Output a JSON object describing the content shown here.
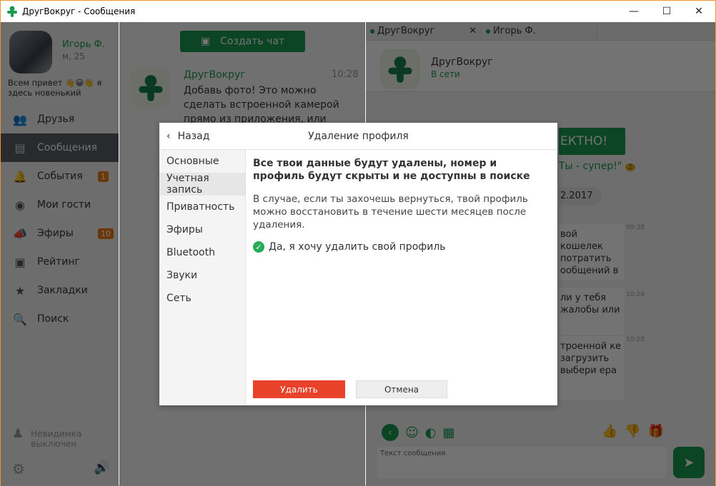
{
  "window": {
    "title": "ДругВокруг - Сообщения",
    "accent": "#1b9a4f",
    "border": "#f0922e"
  },
  "profile": {
    "name": "Игорь Ф.",
    "meta": "м, 25",
    "status": "Всем привет 👋😀👋 я здесь новенький"
  },
  "nav": [
    {
      "label": "Друзья",
      "icon": "people-icon"
    },
    {
      "label": "Сообщения",
      "icon": "chat-icon",
      "active": true
    },
    {
      "label": "События",
      "icon": "bell-icon",
      "badge": "1"
    },
    {
      "label": "Мои гости",
      "icon": "eye-icon"
    },
    {
      "label": "Эфиры",
      "icon": "megaphone-icon",
      "badge": "10"
    },
    {
      "label": "Рейтинг",
      "icon": "rating-icon"
    },
    {
      "label": "Закладки",
      "icon": "star-icon"
    },
    {
      "label": "Поиск",
      "icon": "search-icon"
    }
  ],
  "invisible": {
    "line1": "Невидимка",
    "line2": "выключен"
  },
  "middle": {
    "new_chat": "Создать чат",
    "chat": {
      "name": "ДругВокруг",
      "time": "10:28",
      "preview": "Добавь фото! Это можно сделать встроенной камерой прямо из приложения, или же загрузить"
    }
  },
  "right": {
    "tabs": [
      {
        "label": "ДругВокруг"
      },
      {
        "label": "Игорь Ф."
      }
    ],
    "header": {
      "name": "ДругВокруг",
      "status": "В сети"
    },
    "banner": "ЕКТНО!",
    "super": "Ты - супер!\"",
    "super_badge": "2",
    "date": "2.2017",
    "messages": [
      {
        "text": "вой кошелек потратить ообщений в",
        "time": "09:38"
      },
      {
        "text": "ли у тебя жалобы или",
        "time": "10:28"
      },
      {
        "text": "троенной ке загрузить выбери ера",
        "time": "10:28"
      }
    ],
    "input_placeholder": "Текст сообщения"
  },
  "modal": {
    "back": "Назад",
    "title": "Удаление профиля",
    "menu": [
      "Основные",
      "Учетная запись",
      "Приватность",
      "Эфиры",
      "Bluetooth",
      "Звуки",
      "Сеть"
    ],
    "active_menu": "Учетная запись",
    "heading": "Все твои данные будут удалены, номер и профиль будут скрыты и не доступны в поиске",
    "text": "В случае, если ты захочешь вернуться, твой профиль можно восстановить в течение шести месяцев после удаления.",
    "confirm": "Да, я хочу удалить свой профиль",
    "confirm_checked": true,
    "delete": "Удалить",
    "cancel": "Отмена"
  }
}
